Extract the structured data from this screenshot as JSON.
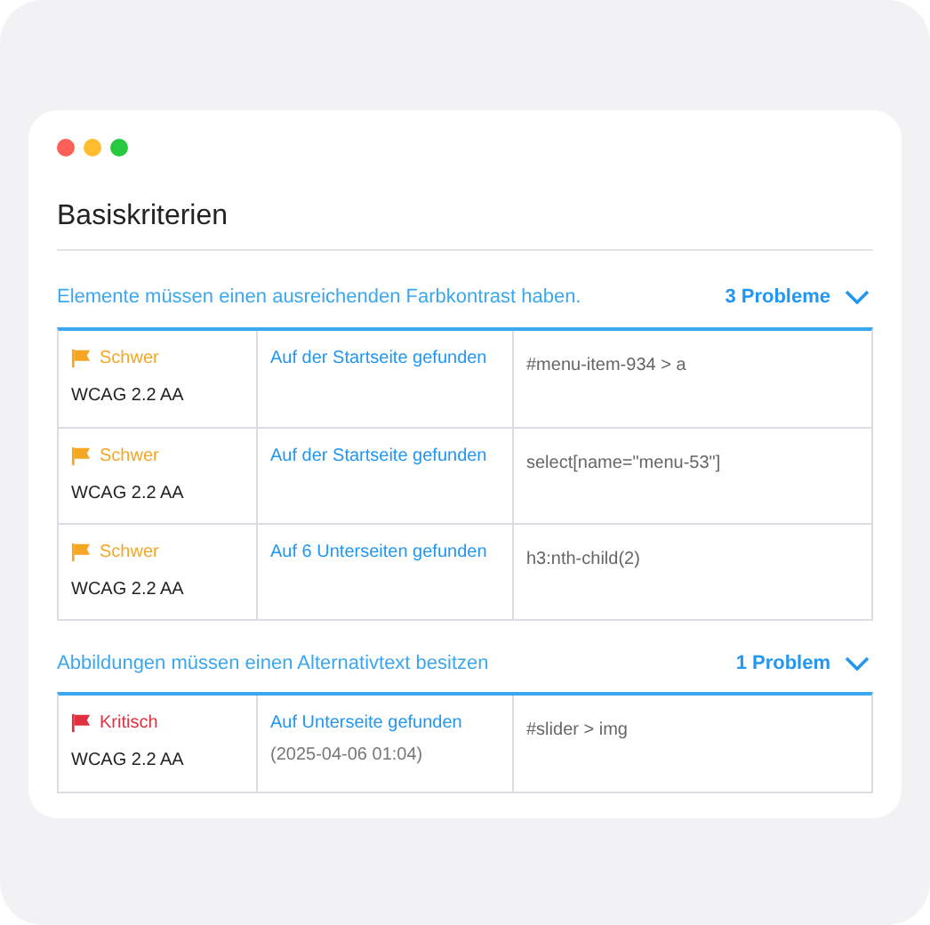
{
  "window": {
    "title": "Basiskriterien"
  },
  "sections": [
    {
      "title": "Elemente müssen einen ausreichenden Farbkontrast haben.",
      "count": "3 Probleme",
      "expanded": true,
      "rows": [
        {
          "kind": "severe",
          "severity_label": "Schwer",
          "standard": "WCAG 2.2 AA",
          "found": "Auf der Startseite gefunden",
          "selector": "#menu-item-934 > a"
        },
        {
          "kind": "severe",
          "severity_label": "Schwer",
          "standard": "WCAG 2.2 AA",
          "found": "Auf der Startseite gefunden",
          "selector": "select[name=\"menu-53\"]"
        },
        {
          "kind": "severe",
          "severity_label": "Schwer",
          "standard": "WCAG 2.2 AA",
          "found": "Auf 6 Unterseiten gefunden",
          "selector": "h3:nth-child(2)"
        }
      ]
    },
    {
      "title": "Abbildungen müssen einen Alternativtext besitzen",
      "count": "1 Problem",
      "expanded": true,
      "rows": [
        {
          "kind": "critical",
          "severity_label": "Kritisch",
          "standard": "WCAG 2.2 AA",
          "found": "Auf Unterseite gefunden",
          "found_date": "(2025-04-06 01:04)",
          "selector": "#slider > img"
        }
      ]
    }
  ]
}
